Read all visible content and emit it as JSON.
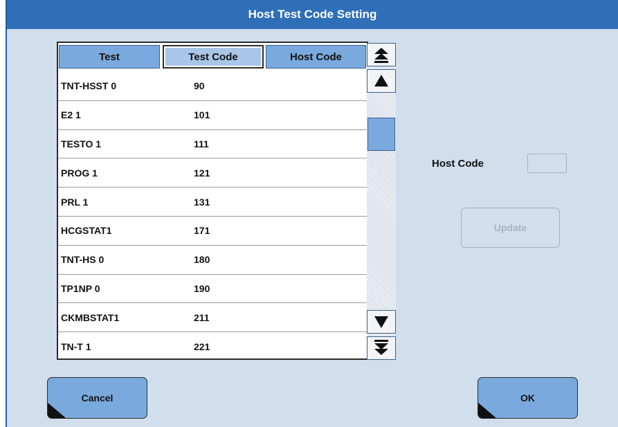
{
  "window": {
    "title": "Host Test Code Setting"
  },
  "table": {
    "columns": [
      "Test",
      "Test Code",
      "Host Code"
    ],
    "rows": [
      {
        "test": "TNT-HSST 0",
        "test_code": "90",
        "host_code": ""
      },
      {
        "test": "E2 1",
        "test_code": "101",
        "host_code": ""
      },
      {
        "test": "TESTO 1",
        "test_code": "111",
        "host_code": ""
      },
      {
        "test": "PROG 1",
        "test_code": "121",
        "host_code": ""
      },
      {
        "test": "PRL 1",
        "test_code": "131",
        "host_code": ""
      },
      {
        "test": "HCGSTAT1",
        "test_code": "171",
        "host_code": ""
      },
      {
        "test": "TNT-HS 0",
        "test_code": "180",
        "host_code": ""
      },
      {
        "test": "TP1NP 0",
        "test_code": "190",
        "host_code": ""
      },
      {
        "test": "CKMBSTAT1",
        "test_code": "211",
        "host_code": ""
      },
      {
        "test": "TN-T 1",
        "test_code": "221",
        "host_code": ""
      }
    ]
  },
  "scrollbar": {
    "icons": [
      "scroll-top-icon",
      "scroll-up-icon",
      "scroll-down-icon",
      "scroll-bottom-icon"
    ]
  },
  "host_code": {
    "label": "Host Code",
    "value": ""
  },
  "buttons": {
    "update": "Update",
    "cancel": "Cancel",
    "ok": "OK"
  },
  "colors": {
    "title_bar": "#2e6fb8",
    "background": "#d1deec",
    "button": "#7aa9dd"
  }
}
